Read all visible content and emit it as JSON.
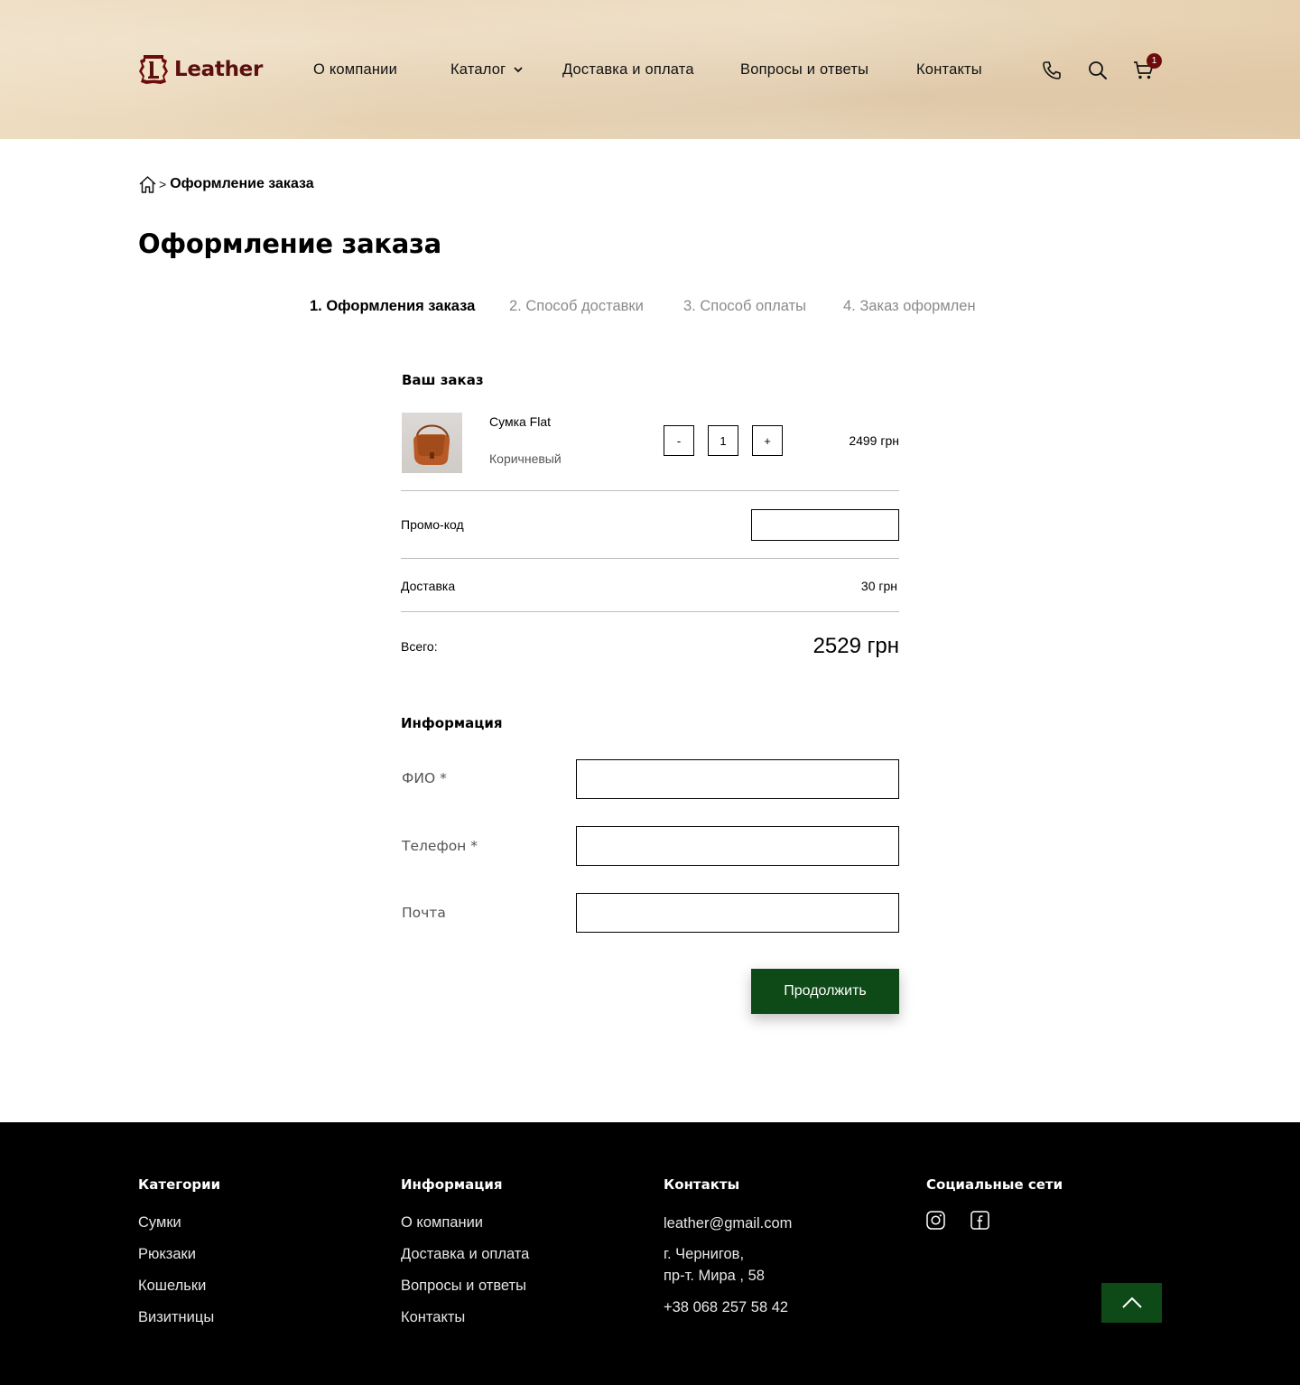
{
  "brand": {
    "name": "Leather"
  },
  "nav": {
    "items": [
      {
        "label": "О компании"
      },
      {
        "label": "Каталог"
      },
      {
        "label": "Доставка и оплата"
      },
      {
        "label": "Вопросы и ответы"
      },
      {
        "label": "Контакты"
      }
    ],
    "cart_count": "1"
  },
  "breadcrumb": {
    "separator": ">",
    "current": "Оформление заказа"
  },
  "page_title": "Оформление заказа",
  "steps": [
    {
      "label": "1. Оформления заказа",
      "active": true
    },
    {
      "label": "2. Способ доставки",
      "active": false
    },
    {
      "label": "3. Способ оплаты",
      "active": false
    },
    {
      "label": "4. Заказ оформлен",
      "active": false
    }
  ],
  "order": {
    "title": "Ваш заказ",
    "item": {
      "name": "Сумка Flat",
      "color": "Коричневый",
      "qty": "1",
      "minus": "-",
      "plus": "+",
      "price": "2499 грн"
    },
    "promo_label": "Промо-код",
    "promo_value": "",
    "delivery_label": "Доставка",
    "delivery_value": "30 грн",
    "total_label": "Всего:",
    "total_value": "2529 грн"
  },
  "info": {
    "title": "Информация",
    "fields": [
      {
        "label": "ФИО *",
        "value": ""
      },
      {
        "label": "Телефон *",
        "value": ""
      },
      {
        "label": "Почта",
        "value": ""
      }
    ],
    "submit": "Продолжить"
  },
  "footer": {
    "categories": {
      "title": "Категории",
      "items": [
        "Сумки",
        "Рюкзаки",
        "Кошельки",
        "Визитницы"
      ]
    },
    "information": {
      "title": "Информация",
      "items": [
        "О компании",
        "Доставка и оплата",
        "Вопросы и ответы",
        "Контакты"
      ]
    },
    "contacts": {
      "title": "Контакты",
      "email": "leather@gmail.com",
      "address_line1": "г. Чернигов,",
      "address_line2": "пр-т. Мира , 58",
      "phone": "+38 068 257 58 42"
    },
    "social": {
      "title": "Социальные сети",
      "icons": [
        "instagram-icon",
        "facebook-icon"
      ]
    }
  },
  "colors": {
    "brand": "#5b0f0f",
    "accent_green": "#0e4a17",
    "cart_badge": "#6d0c0c",
    "muted": "#8a8a8a"
  }
}
